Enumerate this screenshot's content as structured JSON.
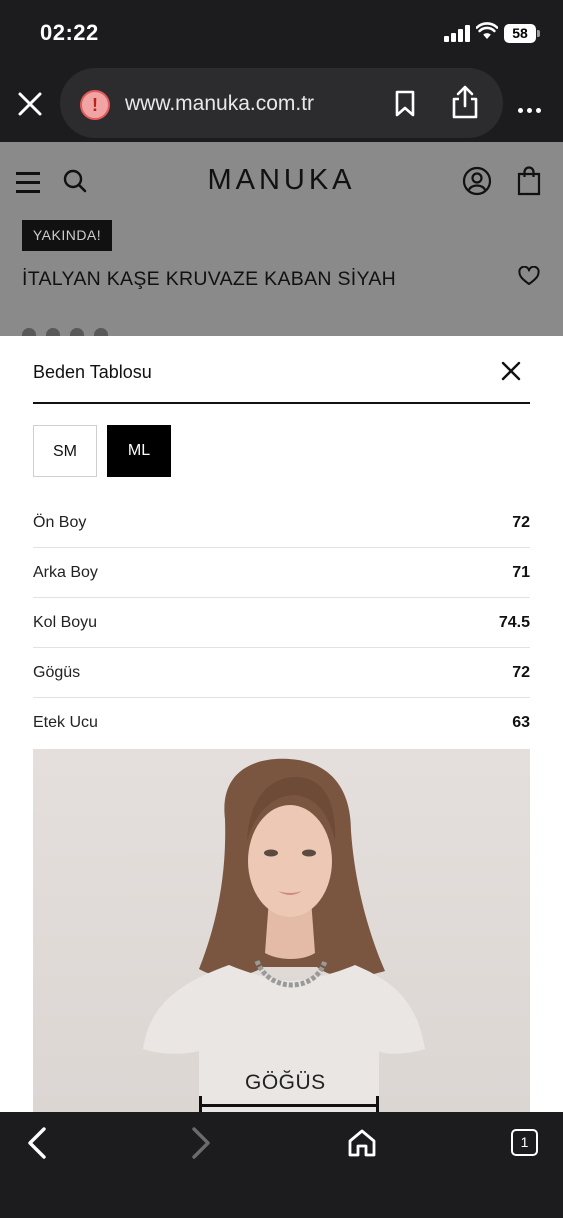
{
  "status_bar": {
    "time": "02:22",
    "battery": "58"
  },
  "browser": {
    "url": "www.manuka.com.tr"
  },
  "site": {
    "brand": "MANUKA",
    "badge": "YAKINDA!",
    "product_title": "İTALYAN KAŞE KRUVAZE KABAN SİYAH"
  },
  "modal": {
    "title": "Beden Tablosu",
    "sizes": [
      {
        "label": "SM",
        "selected": false
      },
      {
        "label": "ML",
        "selected": true
      }
    ],
    "measurements": [
      {
        "label": "Ön Boy",
        "value": "72"
      },
      {
        "label": "Arka Boy",
        "value": "71"
      },
      {
        "label": "Kol Boyu",
        "value": "74.5"
      },
      {
        "label": "Gögüs",
        "value": "72"
      },
      {
        "label": "Etek Ucu",
        "value": "63"
      }
    ],
    "image": {
      "chest_label": "GÖĞÜS"
    }
  },
  "toolbar": {
    "tab_count": "1"
  },
  "icons": {
    "status": [
      "signal-icon",
      "wifi-icon",
      "battery-icon"
    ],
    "browser": [
      "close-tab-icon",
      "warning-icon",
      "bookmark-icon",
      "share-icon",
      "more-icon"
    ],
    "site": [
      "menu-icon",
      "search-icon",
      "account-icon",
      "bag-icon",
      "heart-icon"
    ],
    "toolbar": [
      "back-icon",
      "forward-icon",
      "home-icon",
      "tabs-icon"
    ]
  },
  "colors": {
    "selected_size": "#000000",
    "dim_overlay": "#8a8a8a",
    "warning": "#e45a5a"
  }
}
